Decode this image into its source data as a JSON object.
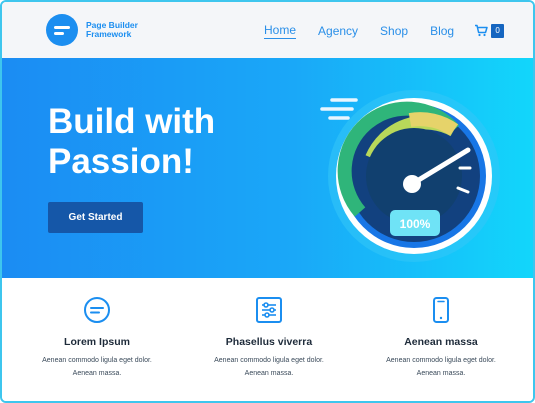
{
  "brand": {
    "name": "Page Builder Framework",
    "logo_icon": "logo-icon"
  },
  "nav": {
    "items": [
      {
        "label": "Home",
        "active": true
      },
      {
        "label": "Agency",
        "active": false
      },
      {
        "label": "Shop",
        "active": false
      },
      {
        "label": "Blog",
        "active": false
      }
    ],
    "cart_icon": "cart-icon",
    "cart_count": "0"
  },
  "hero": {
    "title": "Build with Passion!",
    "button_label": "Get Started",
    "gauge_value": "100%"
  },
  "features": [
    {
      "icon": "bars-circle-icon",
      "title": "Lorem Ipsum",
      "text": "Aenean commodo ligula eget dolor. Aenean massa."
    },
    {
      "icon": "sliders-icon",
      "title": "Phasellus viverra",
      "text": "Aenean commodo ligula eget dolor. Aenean massa."
    },
    {
      "icon": "mobile-icon",
      "title": "Aenean massa",
      "text": "Aenean commodo ligula eget dolor. Aenean massa."
    }
  ],
  "colors": {
    "brand_blue": "#1b8ef0",
    "hero_gradient_start": "#1b8cf3",
    "hero_gradient_end": "#12d6fb",
    "button_dark_blue": "#1557a8",
    "frame_border": "#3ec6ee"
  }
}
